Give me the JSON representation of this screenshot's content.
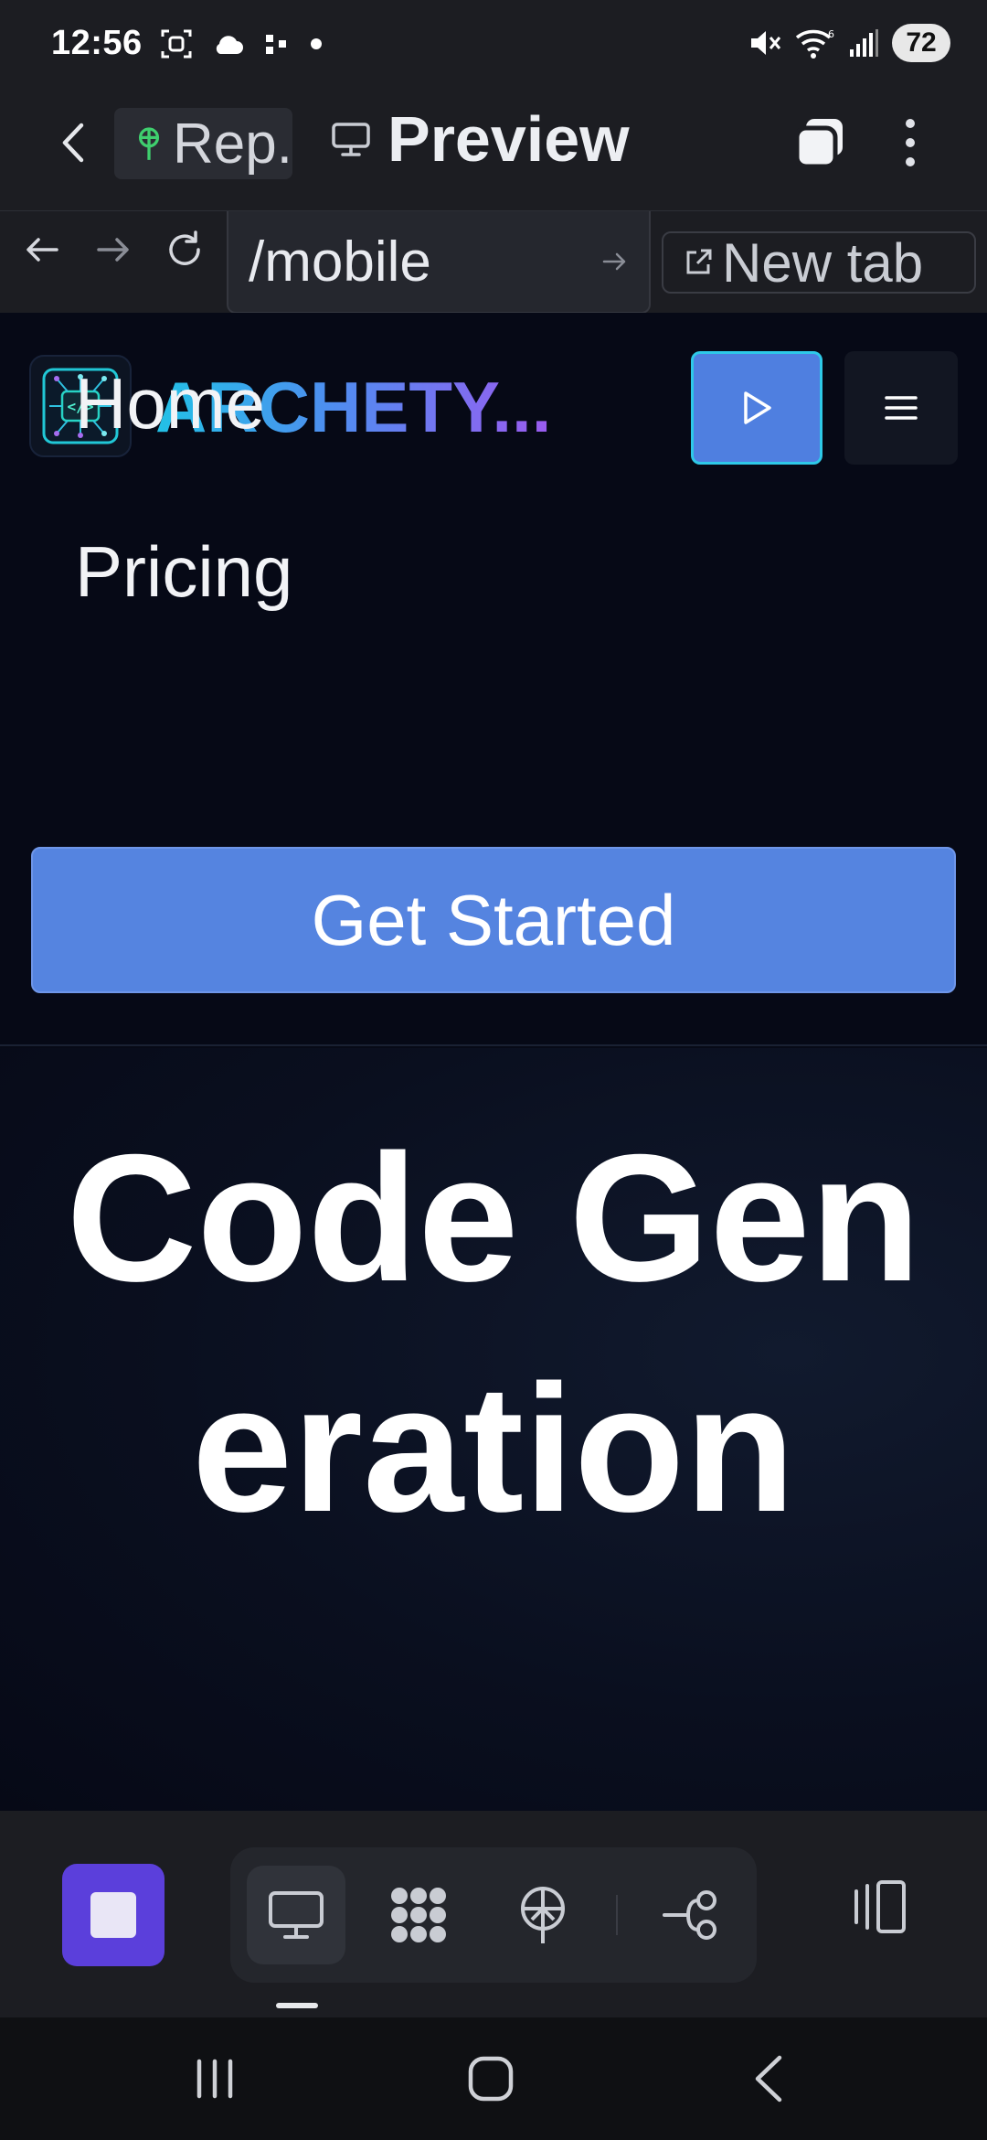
{
  "status_bar": {
    "time": "12:56",
    "battery": "72"
  },
  "app_bar": {
    "repl_tab_label": "Rep.",
    "preview_label": "Preview"
  },
  "url_bar": {
    "url": "/mobile",
    "new_tab_label": "New tab"
  },
  "site": {
    "brand": "ARCHETY...",
    "nav_links": [
      "Home",
      "Pricing"
    ],
    "cta_label": "Get Started",
    "hero_title": "Code Generation"
  },
  "colors": {
    "accent_blue": "#5584e0",
    "stop_purple": "#5b3fdb",
    "page_bg": "#070a17",
    "chrome_bg": "#1c1d22"
  },
  "icons": [
    "screenshot-icon",
    "cloud-icon",
    "dots-icon",
    "mute-icon",
    "wifi-icon",
    "signal-icon",
    "back-icon",
    "repl-icon",
    "monitor-icon",
    "tabs-icon",
    "more-icon",
    "arrow-left-icon",
    "arrow-right-icon",
    "reload-icon",
    "go-icon",
    "external-link-icon",
    "play-icon",
    "menu-icon",
    "stop-icon",
    "webview-icon",
    "grid-icon",
    "deploy-icon",
    "git-icon",
    "layout-icon"
  ]
}
